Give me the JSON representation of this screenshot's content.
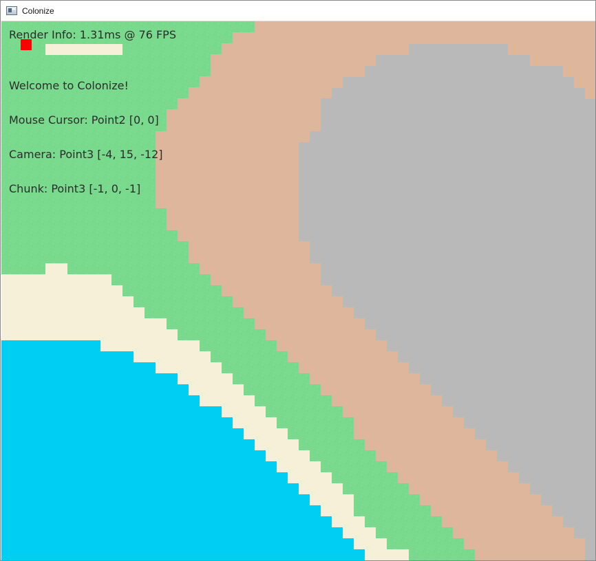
{
  "window": {
    "title": "Colonize",
    "icon": "app-window-icon"
  },
  "hud": {
    "render_info": "Render Info: 1.31ms @ 76 FPS",
    "welcome": "Welcome to Colonize!",
    "mouse_cursor": "Mouse Cursor: Point2 [0, 0]",
    "camera": "Camera: Point3 [-4, 15, -12]",
    "chunk": "Chunk: Point3 [-1, 0, -1]"
  },
  "colors": {
    "grass": "#79d98c",
    "sand": "#f7f0d8",
    "dirt": "#ddb69b",
    "stone": "#b9b9b9",
    "water": "#00cef3",
    "cursor": "#ff0000"
  }
}
